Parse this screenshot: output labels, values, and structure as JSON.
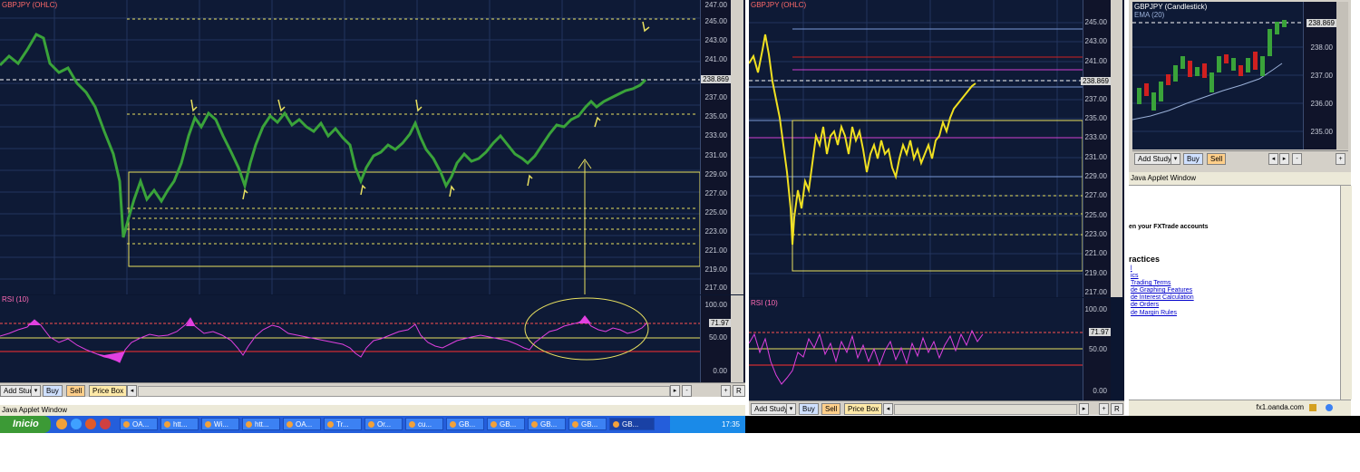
{
  "left_window": {
    "price_title": "GBPJPY (OHLC)",
    "rsi_title": "RSI (10)",
    "price_ticks": [
      "247.00",
      "245.00",
      "243.00",
      "241.00",
      "239.00",
      "237.00",
      "235.00",
      "233.00",
      "231.00",
      "229.00",
      "227.00",
      "225.00",
      "223.00",
      "221.00",
      "219.00",
      "217.00"
    ],
    "current_price": "238.869",
    "rsi_ticks": [
      "100.00",
      "50.00",
      "0.00"
    ],
    "rsi_current": "71.97",
    "toolbar": {
      "add_study": "Add Study",
      "buy": "Buy",
      "sell": "Sell",
      "price_box": "Price Box",
      "r": "R"
    },
    "applet_label": "Java Applet Window"
  },
  "taskbar": {
    "start_label": "Inicio",
    "tasks": [
      "OA...",
      "htt...",
      "Wi...",
      "htt...",
      "OA...",
      "Tr...",
      "Or...",
      "cu...",
      "GB...",
      "GB...",
      "GB...",
      "GB...",
      "GB..."
    ],
    "clock": "17:35"
  },
  "middle_window": {
    "price_title": "GBPJPY (OHLC)",
    "rsi_title": "RSI (10)",
    "price_ticks": [
      "245.00",
      "243.00",
      "241.00",
      "239.00",
      "237.00",
      "235.00",
      "233.00",
      "231.00",
      "229.00",
      "227.00",
      "225.00",
      "223.00",
      "221.00",
      "219.00",
      "217.00"
    ],
    "current_price": "238.869",
    "rsi_ticks": [
      "100.00",
      "50.00",
      "0.00"
    ],
    "rsi_current": "71.97",
    "toolbar": {
      "add_study": "Add Study",
      "buy": "Buy",
      "sell": "Sell",
      "price_box": "Price Box",
      "r": "R"
    }
  },
  "right_window": {
    "chart_title": "GBPJPY (Candlestick)",
    "ema_label": "EMA (20)",
    "current_price": "238.869",
    "price_ticks": [
      "238.00",
      "237.00",
      "236.00",
      "235.00"
    ],
    "toolbar": {
      "add_study": "Add Study",
      "buy": "Buy",
      "sell": "Sell"
    },
    "applet_label": "Java Applet Window",
    "accounts_text": "en your FXTrade accounts",
    "section_title": "ractices",
    "links": [
      "l",
      "ics",
      "Trading Terms",
      "de Graphing Features",
      "de Interest Calculation",
      "de Orders",
      "de Margin Rules"
    ],
    "status_url": "fx1.oanda.com"
  },
  "colors": {
    "chart_bg": "#0e1a36",
    "green_series": "#3aa33a",
    "yellow_series": "#f0e020",
    "rsi_magenta": "#e040e0",
    "support_yellow": "#e8e060"
  }
}
